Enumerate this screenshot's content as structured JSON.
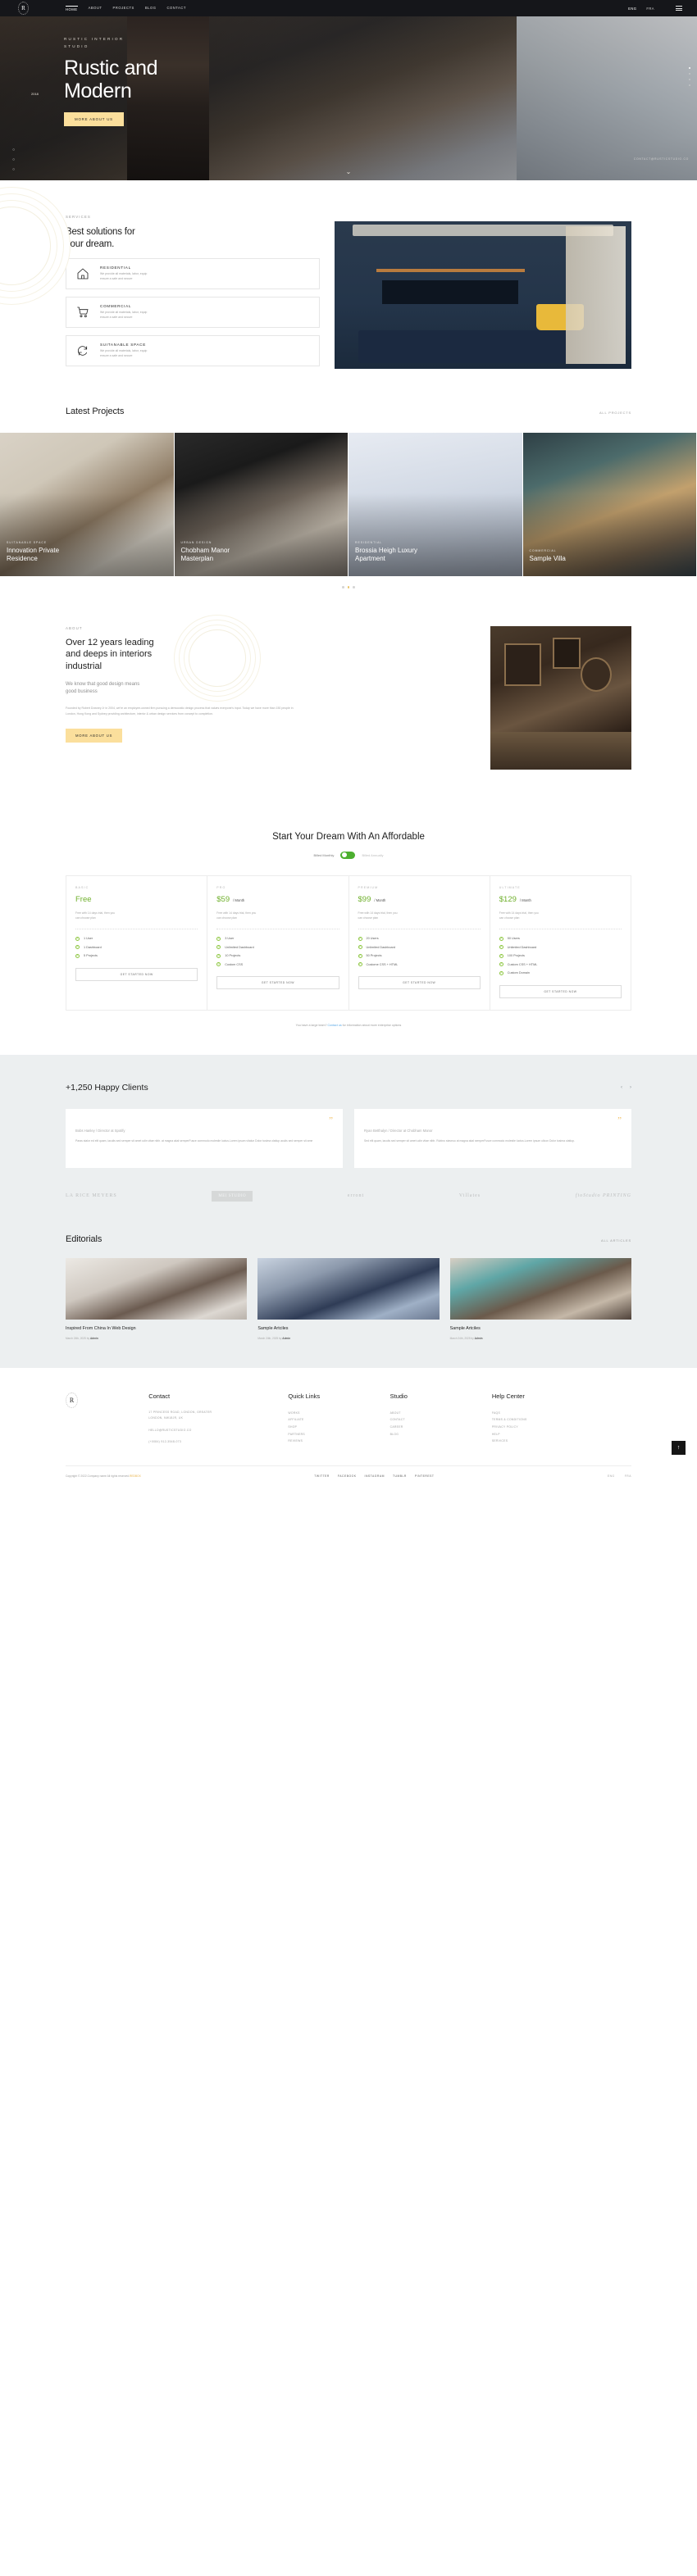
{
  "nav": {
    "logo": "R",
    "links": [
      {
        "label": "HOME",
        "active": true
      },
      {
        "label": "ABOUT",
        "active": false
      },
      {
        "label": "PROJECTS",
        "active": false
      },
      {
        "label": "BLOG",
        "active": false
      },
      {
        "label": "CONTACT",
        "active": false
      }
    ],
    "lang_active": "ENG",
    "lang_other": "FRA",
    "menu_icon": "hamburger-icon"
  },
  "hero": {
    "year": "2018",
    "eyebrow_line1": "RUSTIC INTERIOR",
    "eyebrow_line2": "STUDIO",
    "title_line1": "Rustic and",
    "title_line2": "Modern",
    "cta": "MORE ABOUT US",
    "contact": "CONTACT@RUSTICSTUDIO.CO",
    "scroll_icon": "chevron-down-icon",
    "social": [
      "twitter-icon",
      "facebook-icon",
      "instagram-icon"
    ]
  },
  "services": {
    "eyebrow": "SERVICES",
    "heading_line1": "Best solutions for",
    "heading_line2": "your dream.",
    "cards": [
      {
        "icon": "home-icon",
        "title": "RESIDENTIAL",
        "desc_line1": "We provide all materials, labor, equip",
        "desc_line2": "ensure a safe and secure"
      },
      {
        "icon": "cart-icon",
        "title": "COMMERCIAL",
        "desc_line1": "We provide all materials, labor, equip",
        "desc_line2": "ensure a safe and secure"
      },
      {
        "icon": "refresh-icon",
        "title": "SUITANABLE SPACE",
        "desc_line1": "We provide all materials, labor, equip",
        "desc_line2": "ensure a safe and secure"
      }
    ]
  },
  "projects": {
    "heading": "Latest Projects",
    "all_link": "ALL PROJECTS",
    "items": [
      {
        "category": "SUITANABLE SPACE",
        "name_line1": "Innovation Private",
        "name_line2": "Residence"
      },
      {
        "category": "URBAN DESIGN",
        "name_line1": "Chobham Manor",
        "name_line2": "Masterplan"
      },
      {
        "category": "RESIDENTIAL",
        "name_line1": "Brossia Heigh Luxury",
        "name_line2": "Apartment"
      },
      {
        "category": "COMMERCIAL",
        "name_line1": "Sample Villa",
        "name_line2": ""
      }
    ]
  },
  "about": {
    "eyebrow": "ABOUT",
    "heading_line1": "Over 12 years leading",
    "heading_line2": "and deeps in interiors",
    "heading_line3": "industrial",
    "sub_line1": "We know that good design means",
    "sub_line2": "good business",
    "paragraph": "Founded by Robert Downey Jr in 2004, we're an employee-owned firm pursuing a democratic design process that values everyone's input. Today we have more than 150 people in London, Hong Kong and Sydney providing architecture, interior & urban design services from concept to completion.",
    "cta": "MORE ABOUT US"
  },
  "pricing": {
    "heading": "Start Your Dream With An Affordable",
    "billing_monthly": "Billed Monthly",
    "billing_annually": "Billed Annually",
    "toggle_state": "monthly",
    "trial_line1": "Free with 14 days trial, then you",
    "trial_line2": "can choose plan",
    "cta": "GET STARTED NOW",
    "accent_color": "#6fb02c",
    "plans": [
      {
        "tier": "BASIC",
        "price": "Free",
        "per": "",
        "features": [
          "1 User",
          "1 Dashboard",
          "5 Projects"
        ]
      },
      {
        "tier": "PRO",
        "price": "$59",
        "per": "/ Month",
        "features": [
          "3 User",
          "Unlimited Dashboard",
          "10 Projects",
          "Custom CSS"
        ]
      },
      {
        "tier": "PREMIUM",
        "price": "$99",
        "per": "/ Month",
        "features": [
          "20 Users",
          "Unlimited Dashboard",
          "50 Projects",
          "Custome CSS + HTML"
        ]
      },
      {
        "tier": "ULTIMATE",
        "price": "$129",
        "per": "/ Month",
        "features": [
          "50 Users",
          "Unlimited Dashboard",
          "100 Projects",
          "Custom CSS + HTML",
          "Custom Domain"
        ]
      }
    ],
    "enterprise_pre": "You have a large team? ",
    "enterprise_link": "Contact us",
    "enterprise_post": " for information about more enterprise options"
  },
  "clients": {
    "heading": "+1,250 Happy Clients",
    "prev_icon": "chevron-left-icon",
    "next_icon": "chevron-right-icon",
    "testimonials": [
      {
        "name": "Bobs Hanley",
        "role": "/ Director at Spotify",
        "quote": "Paras stalor ed elit quam, iaculis sed semper sit amet udin vitae nibh. at magna akal semperFusce commodo molestie luctus.Lorem ipsum vitalun Dolor tusima olatiup aculis sed semper sit ame"
      },
      {
        "name": "Ryan Betthalyn",
        "role": "/ Director at Chobham Manor",
        "quote": "Sed elit quam, iaculis sed semper sit amet udin vitae nibh. Rubino staveuo at magna akal semperFusce commodo molestie luctus.Lorem ipsum ulicon Dolor tusima olatiup."
      }
    ],
    "brands": [
      "LA RICE MEYERS",
      "MEI STUDIO",
      "erront",
      "Villates",
      "fioStudio PRINTING"
    ]
  },
  "editorials": {
    "heading": "Editorials",
    "all_link": "ALL ARTICLES",
    "articles": [
      {
        "title": "Inspired From China In Web Design",
        "date": "March 24th, 2025 by ",
        "author": "Admin"
      },
      {
        "title": "Sample Artciles",
        "date": "March 24th, 2025 by ",
        "author": "Admin"
      },
      {
        "title": "Sample Artciles",
        "date": "March 24th, 2025 by ",
        "author": "Admin"
      }
    ]
  },
  "footer": {
    "logo": "R",
    "contact": {
      "heading": "Contact",
      "address_line1": "17 PRINCESS ROAD, LONDON, GREATER",
      "address_line2": "LONDON, NW18JR, UK",
      "email": "HELLO@RUSTICSTUDIO.CO",
      "phone": "(+0084) 912-3548-073"
    },
    "quick_links": {
      "heading": "Quick Links",
      "items": [
        "WORKS",
        "AFFILIATE",
        "SHOP",
        "PARTNERS",
        "REVIEWS"
      ]
    },
    "studio": {
      "heading": "Studio",
      "items": [
        "ABOUT",
        "CONTACT",
        "CAREER",
        "BLOG"
      ]
    },
    "help": {
      "heading": "Help Center",
      "items": [
        "FAQS",
        "TERMS & CONDITIONS",
        "PRIVACY POLICY",
        "HELP",
        "SERVICES"
      ]
    },
    "copyright_pre": "Copyright © 2022.Company name All rights reserved.",
    "copyright_brand": "REDBOX",
    "socials": [
      "TWITTER",
      "FACEBOOK",
      "INSTAGRAM",
      "TUMBLR",
      "PINTEREST"
    ],
    "lang_active": "ENG",
    "lang_other": "FRA",
    "to_top_icon": "arrow-up-icon"
  }
}
